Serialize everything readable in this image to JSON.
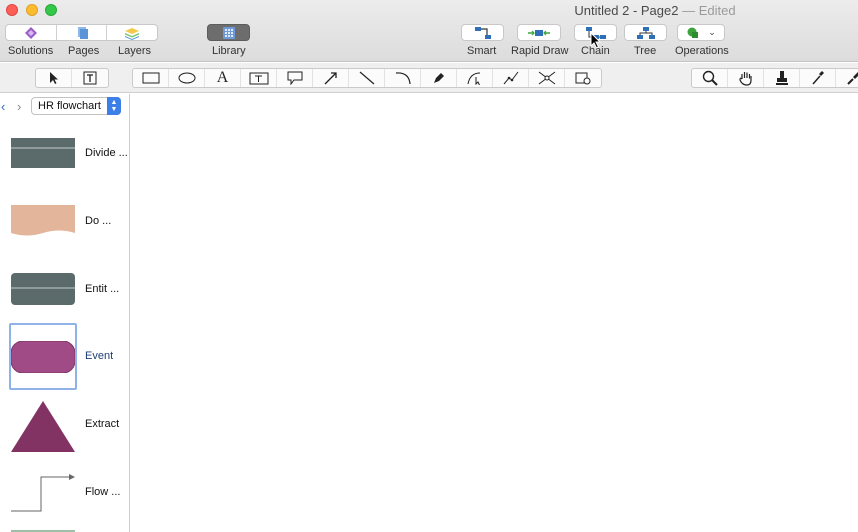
{
  "window": {
    "title": "Untitled 2 - Page2",
    "edited_suffix": "— Edited"
  },
  "toolbar": {
    "solutions": "Solutions",
    "pages": "Pages",
    "layers": "Layers",
    "library": "Library",
    "smart": "Smart",
    "rapid_draw": "Rapid Draw",
    "chain": "Chain",
    "tree": "Tree",
    "operations": "Operations"
  },
  "tools": {
    "left": [
      "pointer-icon",
      "text-box-select-icon"
    ],
    "shapes": [
      "rectangle-icon",
      "ellipse-icon",
      "text-icon",
      "text-block-icon",
      "callout-icon",
      "arrow-icon",
      "line-icon",
      "arc-icon",
      "pen-icon",
      "bezier-icon",
      "polyline-icon",
      "connector-icon",
      "shape-link-icon"
    ],
    "right": [
      "zoom-icon",
      "hand-icon",
      "stamp-icon",
      "eyedropper-icon",
      "format-painter-icon"
    ]
  },
  "sidebar": {
    "library_name": "HR flowchart",
    "shapes": [
      {
        "label": "Divide ...",
        "shape": "divide",
        "color": "#5b6b6b"
      },
      {
        "label": "Do ...",
        "shape": "document",
        "color": "#e3b59a"
      },
      {
        "label": "Entit ...",
        "shape": "entity",
        "color": "#5b6b6b"
      },
      {
        "label": "Event",
        "shape": "event",
        "color": "#a04a86",
        "selected": true
      },
      {
        "label": "Extract",
        "shape": "extract",
        "color": "#823263"
      },
      {
        "label": "Flow ...",
        "shape": "flow",
        "color": "#666666"
      }
    ]
  }
}
